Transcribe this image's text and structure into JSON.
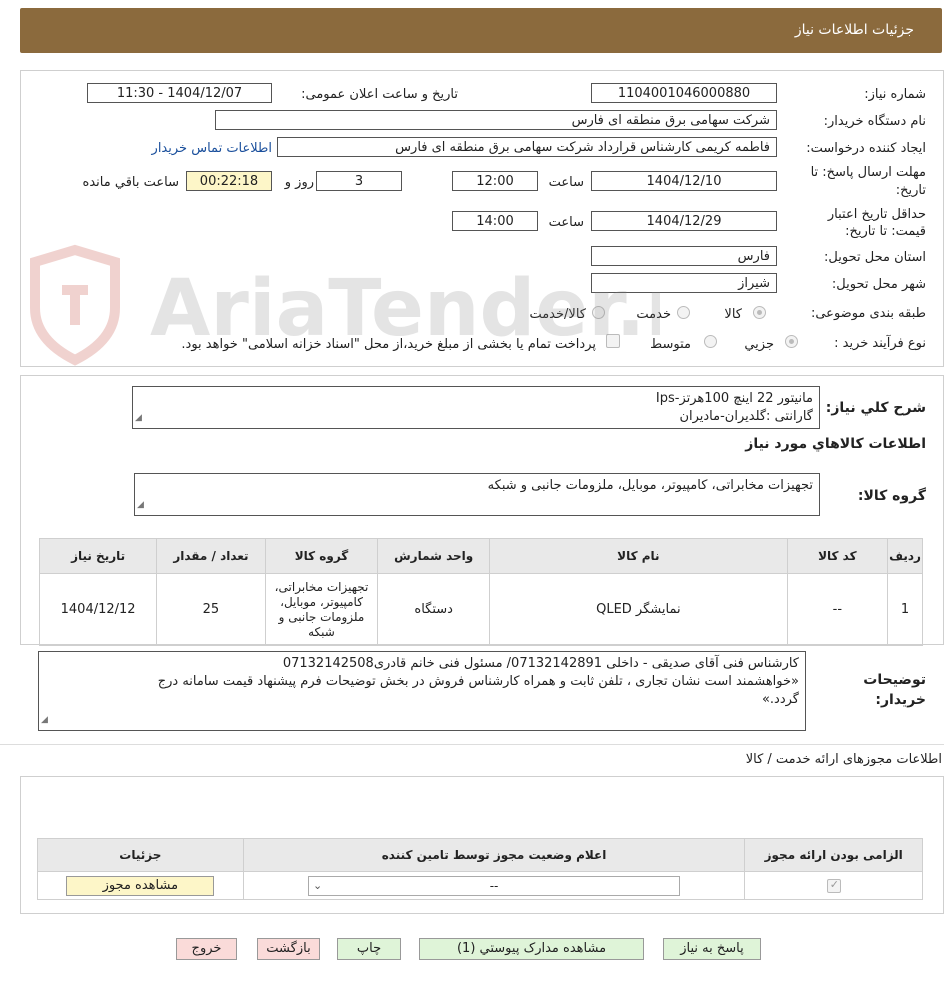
{
  "header": {
    "title": "جزئیات اطلاعات نیاز"
  },
  "form": {
    "need_number_label": "شماره نیاز:",
    "need_number": "1104001046000880",
    "announce_label": "تاریخ و ساعت اعلان عمومی:",
    "announce_value": "1404/12/07 - 11:30",
    "buyer_org_label": "نام دستگاه خریدار:",
    "buyer_org": "شرکت سهامی برق منطقه ای فارس",
    "requester_label": "ایجاد کننده درخواست:",
    "requester": "فاطمه کریمی کارشناس قرارداد شرکت سهامی برق منطقه ای فارس",
    "contact_link": "اطلاعات تماس خریدار",
    "deadline_label_1": "مهلت ارسال پاسخ: تا",
    "deadline_label_2": "تاریخ:",
    "deadline_date": "1404/12/10",
    "time_label": "ساعت",
    "deadline_time": "12:00",
    "days_value": "3",
    "days_label": "روز و",
    "remaining_time": "00:22:18",
    "remaining_label": "ساعت باقي مانده",
    "validity_label_1": "حداقل تاریخ اعتبار",
    "validity_label_2": "قیمت: تا تاریخ:",
    "validity_date": "1404/12/29",
    "validity_time": "14:00",
    "province_label": "استان محل تحویل:",
    "province": "فارس",
    "city_label": "شهر محل تحویل:",
    "city": "شیراز",
    "category_label": "طبقه بندی موضوعی:",
    "category_options": [
      "کالا",
      "خدمت",
      "کالا/خدمت"
    ],
    "process_label": "نوع فرآیند خرید :",
    "process_options": [
      "جزیي",
      "متوسط"
    ],
    "payment_note": "پرداخت تمام یا بخشی از مبلغ خرید،از محل \"اسناد خزانه اسلامی\" خواهد بود."
  },
  "summary": {
    "label": "شرح کلي نیاز:",
    "line1": "مانیتور 22 اینچ      100هرتز-Ips",
    "line2": "گارانتی :گلدیران-مادیران"
  },
  "goods": {
    "section_title": "اطلاعات کالاهاي مورد نیاز",
    "group_label": "گروه کالا:",
    "group_value": "تجهیزات مخابراتی، کامپیوتر، موبایل، ملزومات جانبی و شبکه",
    "columns": [
      "ردیف",
      "کد کالا",
      "نام کالا",
      "واحد شمارش",
      "گروه کالا",
      "تعداد / مقدار",
      "تاریخ نیاز"
    ],
    "rows": [
      {
        "row": "1",
        "code": "--",
        "name": "نمایشگر QLED",
        "unit": "دستگاه",
        "group": "تجهیزات مخابراتی، کامپیوتر، موبایل، ملزومات جانبی و شبکه",
        "qty": "25",
        "date": "1404/12/12"
      }
    ]
  },
  "notes": {
    "label_1": "توضیحات",
    "label_2": "خریدار:",
    "line1": "کارشناس فنی آقای  صدیقی - داخلی 07132142891/ مسئول فنی خانم قادری07132142508",
    "line2": "«خواهشمند است نشان تجاری ، تلفن ثابت و همراه کارشناس فروش در بخش توضیحات فرم پیشنهاد قیمت سامانه درج",
    "line3": "گردد.»"
  },
  "permits": {
    "section_title": "اطلاعات مجوزهای ارائه خدمت / کالا",
    "columns": [
      "الزامی بودن ارائه مجوز",
      "اعلام وضعیت مجوز توسط تامین کننده",
      "جزئیات"
    ],
    "select_value": "--",
    "view_button": "مشاهده مجوز"
  },
  "watermark": {
    "text": "AriaTender.net"
  },
  "buttons": {
    "reply": "پاسخ به نیاز",
    "attachments": "مشاهده مدارک پیوستي (1)",
    "print": "چاپ",
    "back": "بازگشت",
    "exit": "خروج"
  }
}
